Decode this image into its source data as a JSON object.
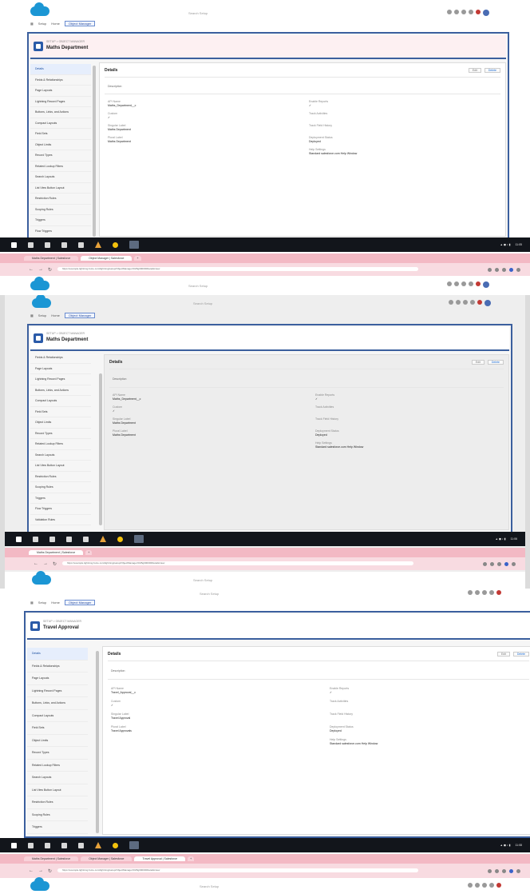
{
  "frames": [
    {
      "search": "Search Setup",
      "setup_label": "Setup",
      "home_label": "Home",
      "object_manager_label": "Object Manager",
      "breadcrumb": "SETUP > OBJECT MANAGER",
      "title": "Maths Department",
      "sidebar": [
        "Details",
        "Fields & Relationships",
        "Page Layouts",
        "Lightning Record Pages",
        "Buttons, Links, and Actions",
        "Compact Layouts",
        "Field Sets",
        "Object Limits",
        "Record Types",
        "Related Lookup Filters",
        "Search Layouts",
        "List View Button Layout",
        "Restriction Rules",
        "Scoping Rules",
        "Triggers",
        "Flow Triggers"
      ],
      "details_title": "Details",
      "description_label": "Description",
      "edit_label": "Edit",
      "delete_label": "Delete",
      "left_fields": [
        {
          "label": "API Name",
          "value": "Maths_Department__c"
        },
        {
          "label": "Custom",
          "value": "✓"
        },
        {
          "label": "Singular Label",
          "value": "Maths Department"
        },
        {
          "label": "Plural Label",
          "value": "Maths Department"
        }
      ],
      "right_fields": [
        {
          "label": "Enable Reports",
          "value": "✓"
        },
        {
          "label": "Track Activities",
          "value": ""
        },
        {
          "label": "Track Field History",
          "value": ""
        },
        {
          "label": "Deployment Status",
          "value": "Deployed"
        },
        {
          "label": "Help Settings",
          "value": "Standard salesforce.com Help Window"
        }
      ],
      "browser_tabs": [
        "Maths Department | Salesforce",
        "Object Manager | Salesforce"
      ],
      "url": "https://example.lightning.force.com/lightning/setup/ObjectManager/01I5g000000Details/view",
      "clock": "11:05"
    },
    {
      "search": "Search Setup",
      "setup_label": "Setup",
      "home_label": "Home",
      "object_manager_label": "Object Manager",
      "breadcrumb": "SETUP > OBJECT MANAGER",
      "title": "Maths Department",
      "sidebar": [
        "Fields & Relationships",
        "Page Layouts",
        "Lightning Record Pages",
        "Buttons, Links, and Actions",
        "Compact Layouts",
        "Field Sets",
        "Object Limits",
        "Record Types",
        "Related Lookup Filters",
        "Search Layouts",
        "List View Button Layout",
        "Restriction Rules",
        "Scoping Rules",
        "Triggers",
        "Flow Triggers",
        "Validation Rules"
      ],
      "details_title": "Details",
      "description_label": "Description",
      "edit_label": "Edit",
      "delete_label": "Delete",
      "left_fields": [
        {
          "label": "API Name",
          "value": "Maths_Department__c"
        },
        {
          "label": "Custom",
          "value": "✓"
        },
        {
          "label": "Singular Label",
          "value": "Maths Department"
        },
        {
          "label": "Plural Label",
          "value": "Maths Department"
        }
      ],
      "right_fields": [
        {
          "label": "Enable Reports",
          "value": "✓"
        },
        {
          "label": "Track Activities",
          "value": ""
        },
        {
          "label": "Track Field History",
          "value": ""
        },
        {
          "label": "Deployment Status",
          "value": "Deployed"
        },
        {
          "label": "Help Settings",
          "value": "Standard salesforce.com Help Window"
        }
      ],
      "browser_tabs": [
        "Maths Department | Salesforce"
      ],
      "url": "https://example.lightning.force.com/lightning/setup/ObjectManager/01I5g000000Details/view",
      "clock": "11:06"
    },
    {
      "search": "Search Setup",
      "setup_label": "Setup",
      "home_label": "Home",
      "object_manager_label": "Object Manager",
      "breadcrumb": "SETUP > OBJECT MANAGER",
      "title": "Travel Approval",
      "sidebar": [
        "Details",
        "Fields & Relationships",
        "Page Layouts",
        "Lightning Record Pages",
        "Buttons, Links, and Actions",
        "Compact Layouts",
        "Field Sets",
        "Object Limits",
        "Record Types",
        "Related Lookup Filters",
        "Search Layouts",
        "List View Button Layout",
        "Restriction Rules",
        "Scoping Rules",
        "Triggers",
        "Flow Triggers"
      ],
      "details_title": "Details",
      "description_label": "Description",
      "edit_label": "Edit",
      "delete_label": "Delete",
      "left_fields": [
        {
          "label": "API Name",
          "value": "Travel_Approval__c"
        },
        {
          "label": "Custom",
          "value": "✓"
        },
        {
          "label": "Singular Label",
          "value": "Travel Approval"
        },
        {
          "label": "Plural Label",
          "value": "Travel Approvals"
        }
      ],
      "right_fields": [
        {
          "label": "Enable Reports",
          "value": "✓"
        },
        {
          "label": "Track Activities",
          "value": ""
        },
        {
          "label": "Track Field History",
          "value": ""
        },
        {
          "label": "Deployment Status",
          "value": "Deployed"
        },
        {
          "label": "Help Settings",
          "value": "Standard salesforce.com Help Window"
        }
      ],
      "browser_tabs": [
        "Maths Department | Salesforce",
        "Object Manager | Salesforce",
        "Travel Approval | Salesforce"
      ],
      "url": "https://example.lightning.force.com/lightning/setup/ObjectManager/01I5g000000Details/view",
      "clock": "11:08"
    }
  ]
}
